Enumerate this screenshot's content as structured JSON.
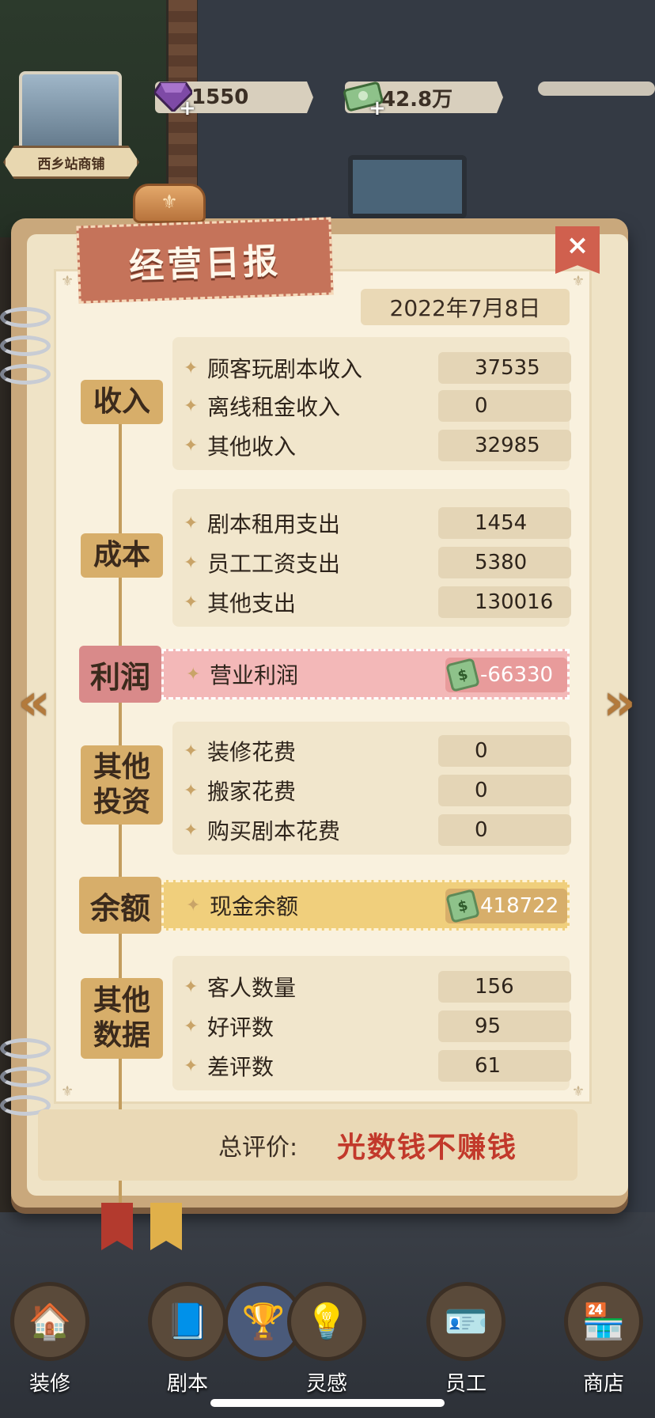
{
  "top_bar": {
    "shop_name": "西乡站商铺",
    "gems": "1550",
    "cash": "42.8万"
  },
  "report": {
    "title": "经营日报",
    "date": "2022年7月8日",
    "close_label": "×",
    "income": {
      "label": "收入",
      "rows": [
        {
          "label": "顾客玩剧本收入",
          "value": "37535"
        },
        {
          "label": "离线租金收入",
          "value": "0"
        },
        {
          "label": "其他收入",
          "value": "32985"
        }
      ]
    },
    "cost": {
      "label": "成本",
      "rows": [
        {
          "label": "剧本租用支出",
          "value": "1454"
        },
        {
          "label": "员工工资支出",
          "value": "5380"
        },
        {
          "label": "其他支出",
          "value": "130016"
        }
      ]
    },
    "profit": {
      "label": "利润",
      "title": "营业利润",
      "value": "-66330"
    },
    "investment": {
      "label_line1": "其他",
      "label_line2": "投资",
      "rows": [
        {
          "label": "装修花费",
          "value": "0"
        },
        {
          "label": "搬家花费",
          "value": "0"
        },
        {
          "label": "购买剧本花费",
          "value": "0"
        }
      ]
    },
    "balance": {
      "label": "余额",
      "title": "现金余额",
      "value": "418722"
    },
    "other": {
      "label_line1": "其他",
      "label_line2": "数据",
      "rows": [
        {
          "label": "客人数量",
          "value": "156"
        },
        {
          "label": "好评数",
          "value": "95"
        },
        {
          "label": "差评数",
          "value": "61"
        }
      ]
    },
    "summary": {
      "label": "总评价:",
      "value": "光数钱不赚钱"
    }
  },
  "bottom_nav": [
    {
      "label": "装修",
      "icon": "house-icon"
    },
    {
      "label": "剧本",
      "icon": "script-book-icon"
    },
    {
      "label": "",
      "icon": "trophy-icon"
    },
    {
      "label": "灵感",
      "icon": "lightbulb-icon"
    },
    {
      "label": "员工",
      "icon": "employee-card-icon"
    },
    {
      "label": "商店",
      "icon": "shop-icon"
    }
  ],
  "colors": {
    "profit_band": "#f3b8b8",
    "profit_label": "#d98a8a",
    "balance_band": "#f0cf7c",
    "balance_label": "#d7ae6a",
    "summary_text": "#c2392b"
  }
}
